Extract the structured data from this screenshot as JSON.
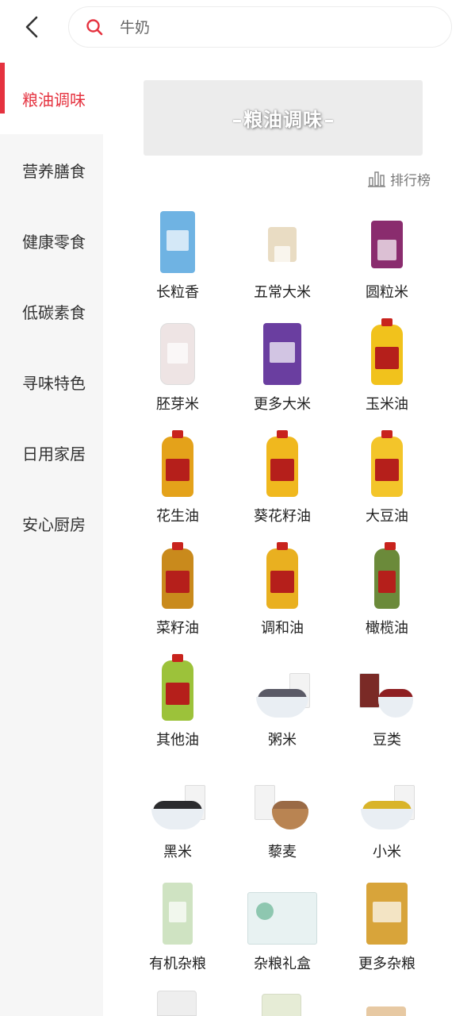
{
  "header": {
    "back_icon": "chevron-left-icon",
    "search_icon": "search-icon",
    "search_placeholder": "牛奶"
  },
  "sidebar": {
    "items": [
      {
        "label": "粮油调味",
        "active": true
      },
      {
        "label": "营养膳食",
        "active": false
      },
      {
        "label": "健康零食",
        "active": false
      },
      {
        "label": "低碳素食",
        "active": false
      },
      {
        "label": "寻味特色",
        "active": false
      },
      {
        "label": "日用家居",
        "active": false
      },
      {
        "label": "安心厨房",
        "active": false
      }
    ]
  },
  "main": {
    "banner_title": "粮油调味",
    "rank_label": "排行榜",
    "rank_icon": "bar-chart-icon",
    "categories": [
      {
        "label": "长粒香"
      },
      {
        "label": "五常大米"
      },
      {
        "label": "圆粒米"
      },
      {
        "label": "胚芽米"
      },
      {
        "label": "更多大米"
      },
      {
        "label": "玉米油"
      },
      {
        "label": "花生油"
      },
      {
        "label": "葵花籽油"
      },
      {
        "label": "大豆油"
      },
      {
        "label": "菜籽油"
      },
      {
        "label": "调和油"
      },
      {
        "label": "橄榄油"
      },
      {
        "label": "其他油"
      },
      {
        "label": "粥米"
      },
      {
        "label": "豆类"
      },
      {
        "label": "黑米"
      },
      {
        "label": "藜麦"
      },
      {
        "label": "小米"
      },
      {
        "label": "有机杂粮"
      },
      {
        "label": "杂粮礼盒"
      },
      {
        "label": "更多杂粮"
      }
    ]
  },
  "colors": {
    "accent": "#e5323f",
    "sidebar_bg": "#f6f6f6",
    "banner_bg": "#ececec"
  }
}
